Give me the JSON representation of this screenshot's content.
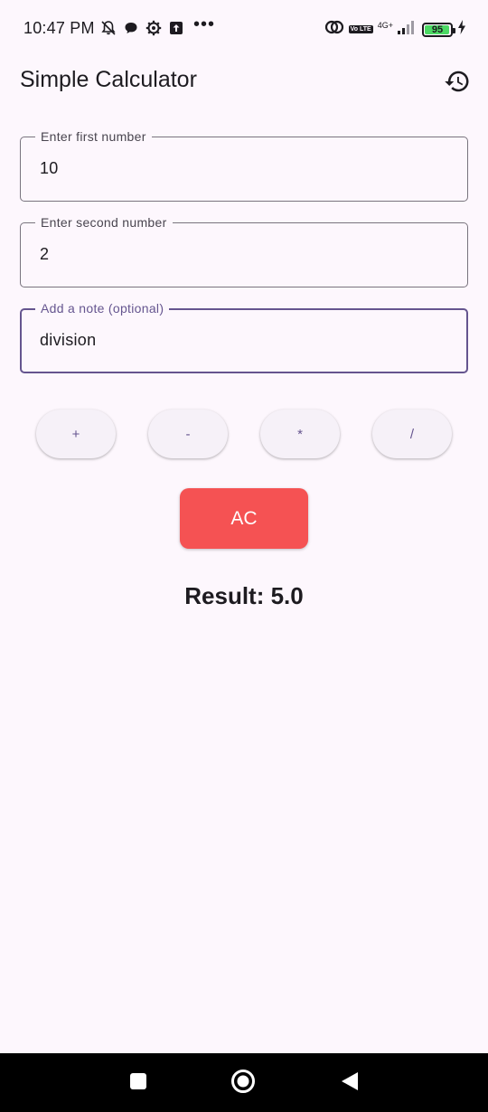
{
  "status_bar": {
    "time": "10:47 PM",
    "more_indicator": "•••",
    "icons_left": [
      "muted-bell-icon",
      "chat-bubble-icon",
      "settings-gear-icon",
      "upload-icon"
    ],
    "icons_right": [
      "hotspot-icon",
      "volte-icon",
      "signal-icon",
      "battery-icon",
      "charging-icon"
    ],
    "volte_label": "Vo LTE",
    "network_type": "4G+",
    "battery_percent": "95",
    "battery_level": 0.95,
    "battery_color": "#4cd964"
  },
  "app_bar": {
    "title": "Simple Calculator",
    "history_icon": "history-icon"
  },
  "fields": {
    "first": {
      "label": "Enter first number",
      "value": "10"
    },
    "second": {
      "label": "Enter second number",
      "value": "2"
    },
    "note": {
      "label": "Add a note (optional)",
      "value": "division"
    }
  },
  "operators": [
    "+",
    "-",
    "*",
    "/"
  ],
  "ac_button": {
    "label": "AC",
    "color": "#f55253"
  },
  "result": {
    "text": "Result: 5.0"
  },
  "colors": {
    "background": "#fdf7fd",
    "accent": "#65558f",
    "outline": "#79747e"
  },
  "nav_bar": {
    "icons": [
      "recents-square-icon",
      "home-circle-icon",
      "back-triangle-icon"
    ]
  }
}
